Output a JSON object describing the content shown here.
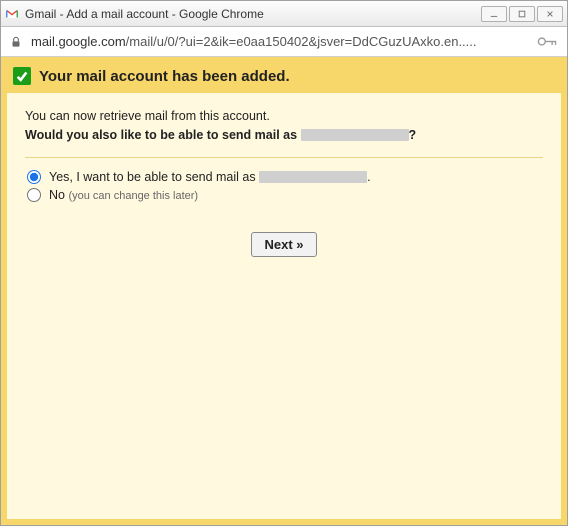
{
  "window": {
    "title": "Gmail - Add a mail account - Google Chrome"
  },
  "address": {
    "url_prefix": "mail.google.com",
    "url_path": "/mail/u/0/?ui=2&ik=e0aa150402&jsver=DdCGuzUAxko.en.....",
    "full": "mail.google.com/mail/u/0/?ui=2&ik=e0aa150402&jsver=DdCGuzUAxko.en....."
  },
  "banner": {
    "heading": "Your mail account has been added."
  },
  "intro": {
    "line1": "You can now retrieve mail from this account.",
    "line2_a": "Would you also like to be able to send mail as",
    "line2_b": "?"
  },
  "options": {
    "yes_prefix": "Yes, I want to be able to send mail as",
    "yes_suffix": ".",
    "no": "No",
    "no_hint": "(you can change this later)",
    "selected": "yes"
  },
  "buttons": {
    "next": "Next »"
  }
}
